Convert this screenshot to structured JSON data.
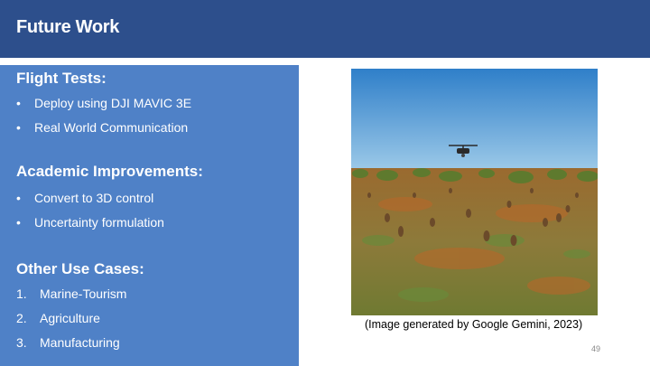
{
  "header": {
    "title": "Future Work"
  },
  "sections": {
    "flight": {
      "title": "Flight Tests:",
      "items": [
        "Deploy using DJI MAVIC 3E",
        "Real World Communication"
      ]
    },
    "academic": {
      "title": "Academic Improvements:",
      "items": [
        "Convert to 3D control",
        "Uncertainty formulation"
      ]
    },
    "other": {
      "title": "Other Use Cases:",
      "items": [
        "Marine-Tourism",
        "Agriculture",
        "Manufacturing"
      ],
      "markers": [
        "1.",
        "2.",
        "3."
      ]
    }
  },
  "bullet_char": "•",
  "image": {
    "caption": "(Image generated by Google Gemini, 2023)"
  },
  "page_number": "49",
  "colors": {
    "header": "#2d4f8c",
    "panel": "#4f81c7",
    "text_on_panel": "#ffffff"
  }
}
